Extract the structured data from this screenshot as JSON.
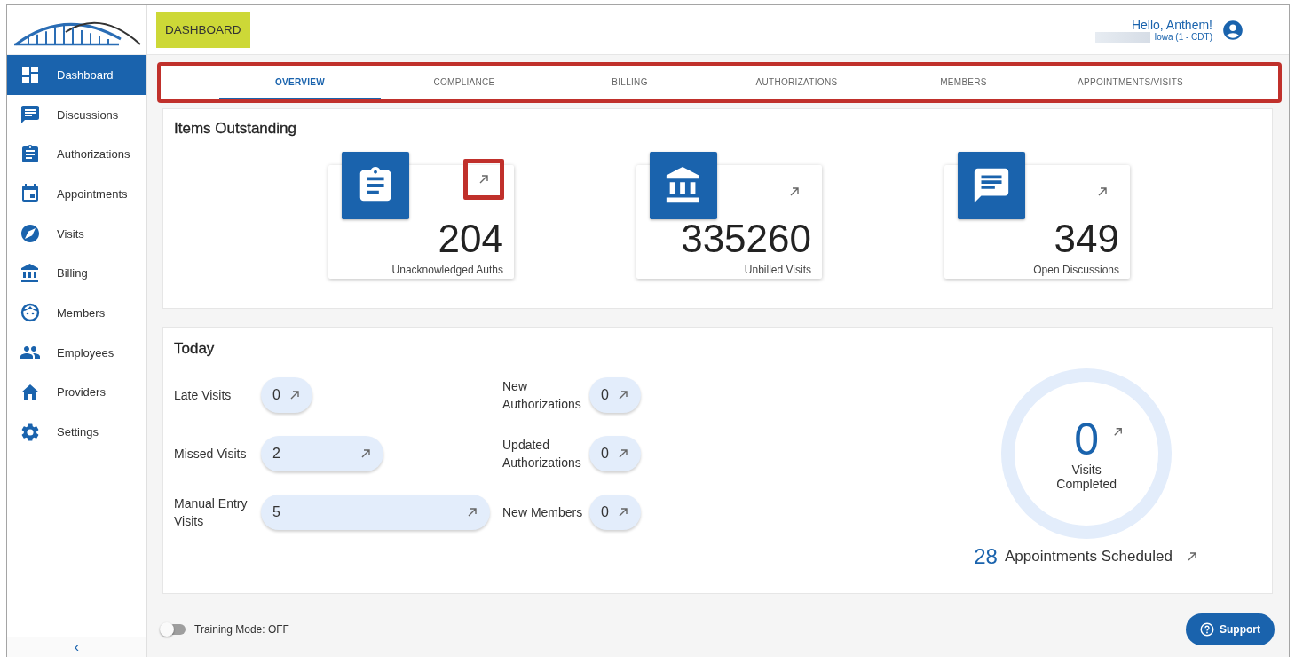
{
  "header": {
    "title": "DASHBOARD",
    "title_highlighted": true,
    "greeting": "Hello, Anthem!",
    "location": "Iowa (1 - CDT)"
  },
  "sidebar": {
    "items": [
      {
        "label": "Dashboard",
        "selected": true
      },
      {
        "label": "Discussions",
        "selected": false
      },
      {
        "label": "Authorizations",
        "selected": false
      },
      {
        "label": "Appointments",
        "selected": false
      },
      {
        "label": "Visits",
        "selected": false
      },
      {
        "label": "Billing",
        "selected": false
      },
      {
        "label": "Members",
        "selected": false
      },
      {
        "label": "Employees",
        "selected": false
      },
      {
        "label": "Providers",
        "selected": false
      },
      {
        "label": "Settings",
        "selected": false
      }
    ],
    "collapse": "‹"
  },
  "tabs_highlighted": true,
  "tabs": [
    {
      "label": "OVERVIEW",
      "selected": true
    },
    {
      "label": "COMPLIANCE",
      "selected": false
    },
    {
      "label": "BILLING",
      "selected": false
    },
    {
      "label": "AUTHORIZATIONS",
      "selected": false
    },
    {
      "label": "MEMBERS",
      "selected": false
    },
    {
      "label": "APPOINTMENTS/VISITS",
      "selected": false
    }
  ],
  "items_outstanding": {
    "title": "Items Outstanding",
    "cards": [
      {
        "value": "204",
        "label": "Unacknowledged Auths",
        "arrow_highlighted": true
      },
      {
        "value": "335260",
        "label": "Unbilled Visits",
        "arrow_highlighted": false
      },
      {
        "value": "349",
        "label": "Open Discussions",
        "arrow_highlighted": false
      }
    ]
  },
  "today": {
    "title": "Today",
    "left": [
      {
        "label": "Late Visits",
        "value": "0"
      },
      {
        "label": "Missed Visits",
        "value": "2"
      },
      {
        "label": "Manual Entry Visits",
        "value": "5"
      }
    ],
    "right": [
      {
        "label": "New Authorizations",
        "value": "0"
      },
      {
        "label": "Updated Authorizations",
        "value": "0"
      },
      {
        "label": "New Members",
        "value": "0"
      }
    ],
    "visits_completed": {
      "value": "0",
      "label": "Visits Completed"
    },
    "appointments": {
      "value": "28",
      "label": "Appointments Scheduled"
    }
  },
  "training_mode": {
    "label": "Training Mode: OFF",
    "on": false
  },
  "support": "Support"
}
